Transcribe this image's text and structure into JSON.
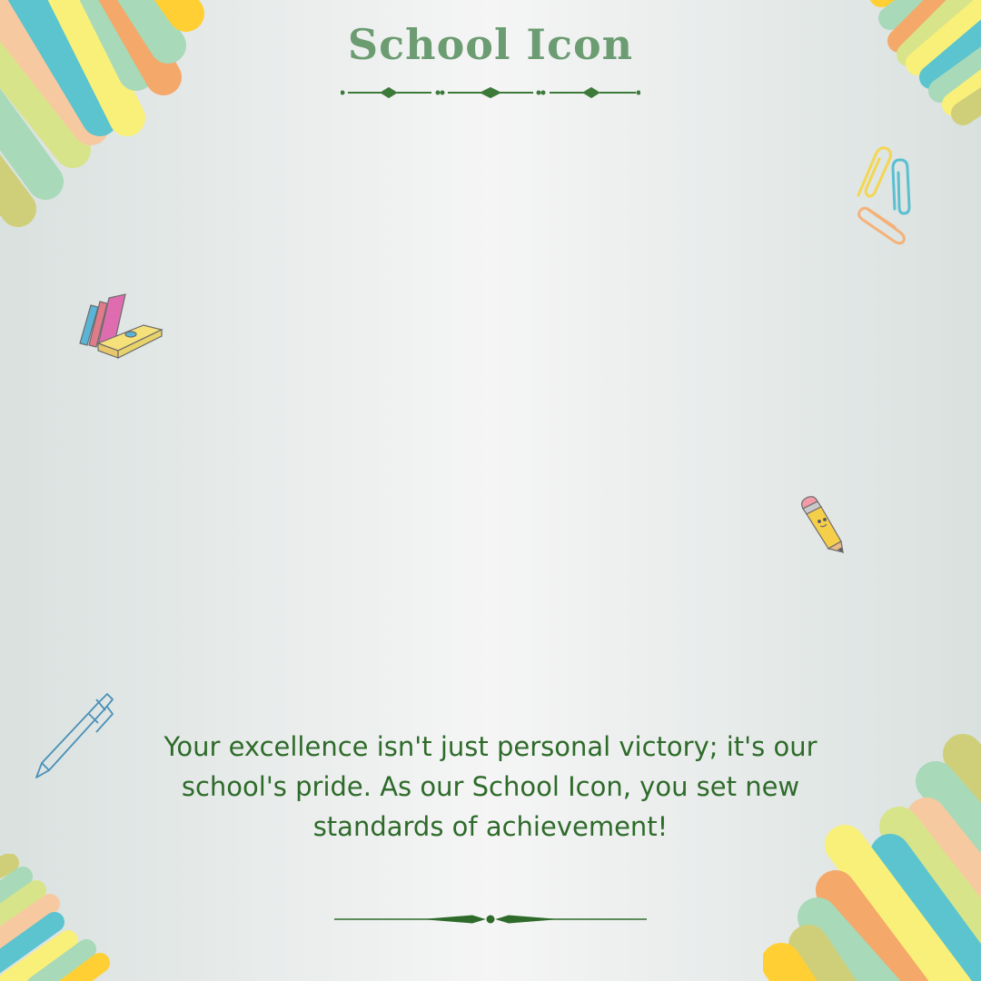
{
  "title": "School Icon",
  "message": "Your excellence isn't just personal victory; it's our school's pride. As our School Icon, you set new standards of achievement!",
  "colors": {
    "title": "#6c9c72",
    "text": "#2e6b2a",
    "ornament": "#3d7a3a",
    "stripes": [
      "#f6e98a",
      "#5bc4cf",
      "#a8d9b8",
      "#f4a86a",
      "#d8e48a",
      "#f9f07a",
      "#cfcf7a",
      "#f7c9a0"
    ]
  },
  "icons": [
    "paper-clips-icon",
    "books-icon",
    "pencil-icon",
    "pen-icon"
  ]
}
